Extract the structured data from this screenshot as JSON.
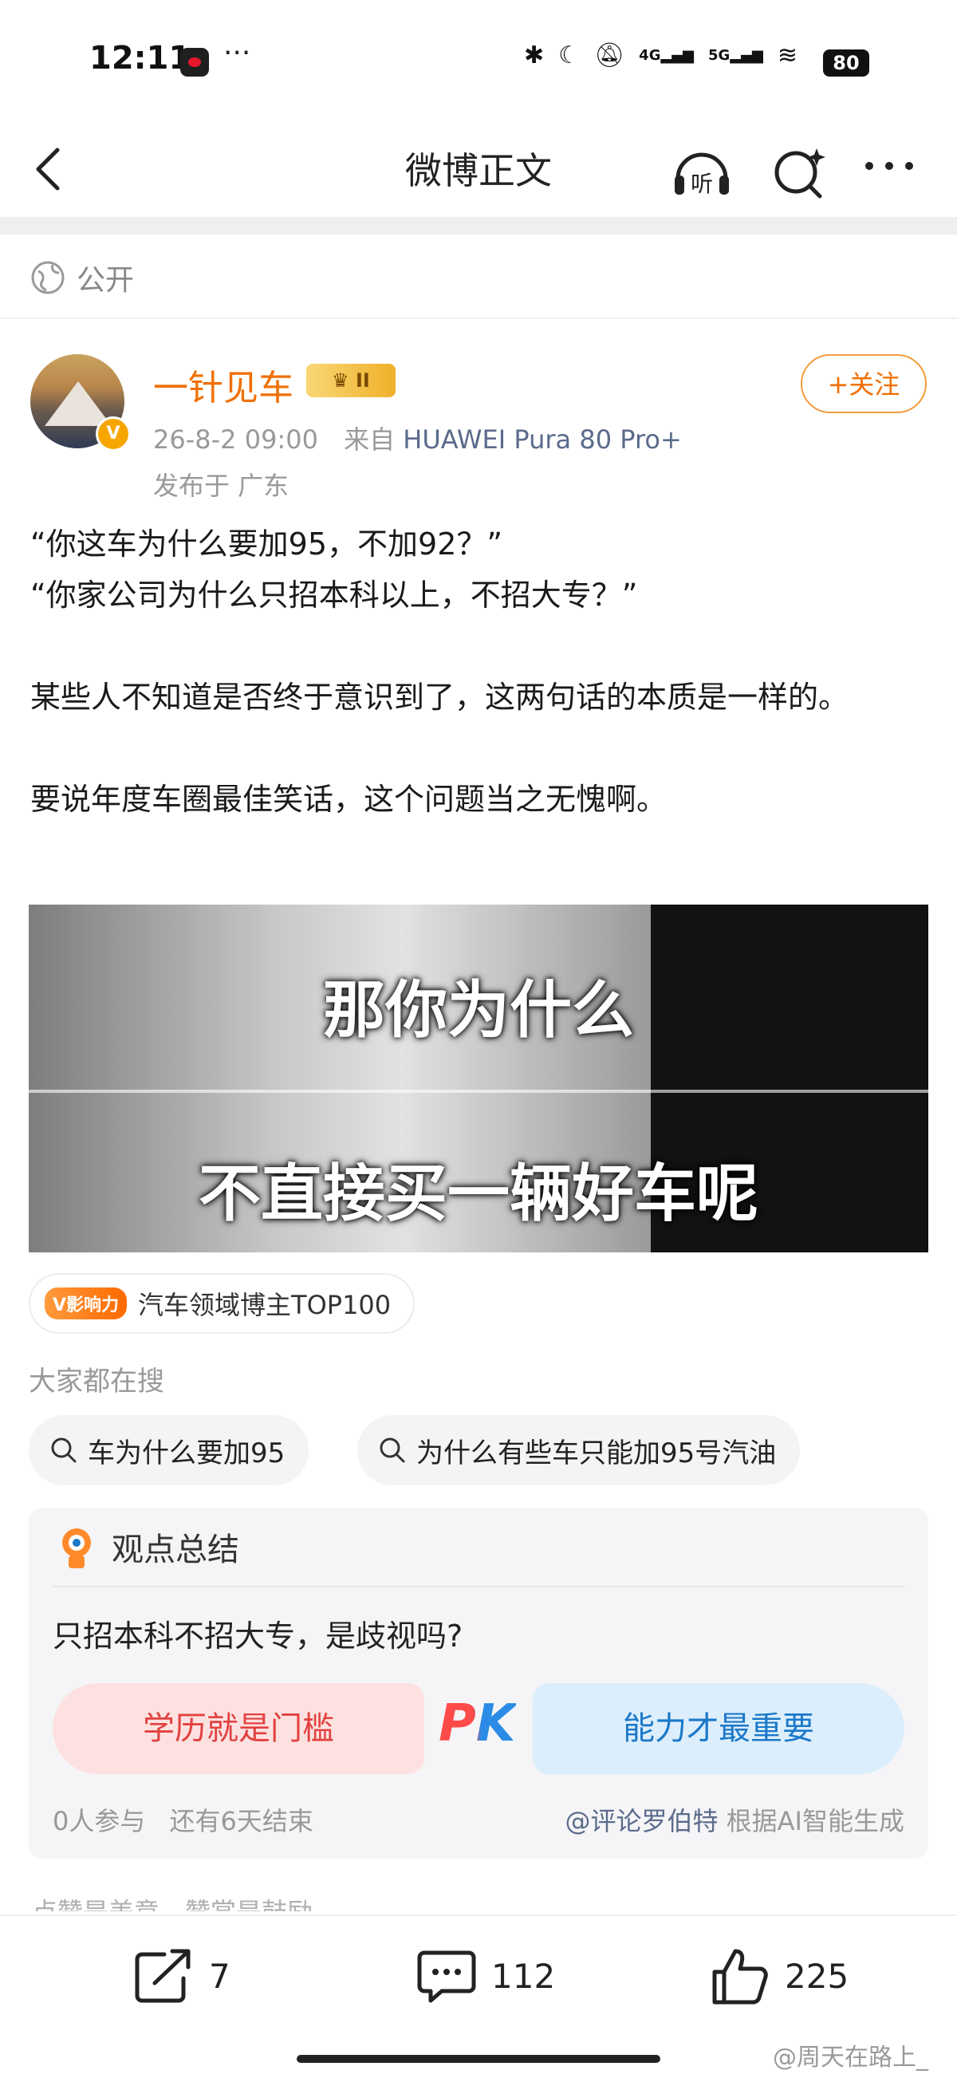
{
  "status_bar": {
    "time": "12:11",
    "more": "···",
    "battery": "80",
    "net1": "4G",
    "net2": "5G"
  },
  "nav": {
    "title": "微博正文",
    "listen_label": "听"
  },
  "visibility": {
    "label": "公开"
  },
  "author": {
    "name": "一针见车",
    "level": "II",
    "verified_mark": "V",
    "timestamp": "26-8-2 09:00",
    "source_prefix": "来自",
    "device": "HUAWEI Pura 80 Pro+",
    "location": "发布于 广东",
    "follow_label": "+关注"
  },
  "post": {
    "text": "“你这车为什么要加95，不加92？”\n“你家公司为什么只招本科以上，不招大专？”\n\n某些人不知道是否终于意识到了，这两句话的本质是一样的。\n\n要说年度车圈最佳笑话，这个问题当之无愧啊。",
    "image_caption_top": "那你为什么",
    "image_caption_bottom": "不直接买一辆好车呢"
  },
  "influence": {
    "tag": "V影响力",
    "label": "汽车领域博主TOP100"
  },
  "searches": {
    "title": "大家都在搜",
    "items": [
      "车为什么要加95",
      "为什么有些车只能加95号汽油"
    ]
  },
  "opinion": {
    "title": "观点总结",
    "question": "只招本科不招大专，是歧视吗?",
    "left_option": "学历就是门槛",
    "pk": "PK",
    "right_option": "能力才最重要",
    "participants": "0人参与",
    "remaining": "还有6天结束",
    "generator_name": "@评论罗伯特",
    "generator_suffix": " 根据AI智能生成"
  },
  "more_text": "点赞是美意，赞赏是鼓励",
  "actions": {
    "repost": "7",
    "comments": "112",
    "likes": "225"
  },
  "watermark": "@周天在路上_",
  "colors": {
    "accent_orange": "#f06f00",
    "pk_red": "#e2413f",
    "pk_blue": "#1b78c8"
  }
}
